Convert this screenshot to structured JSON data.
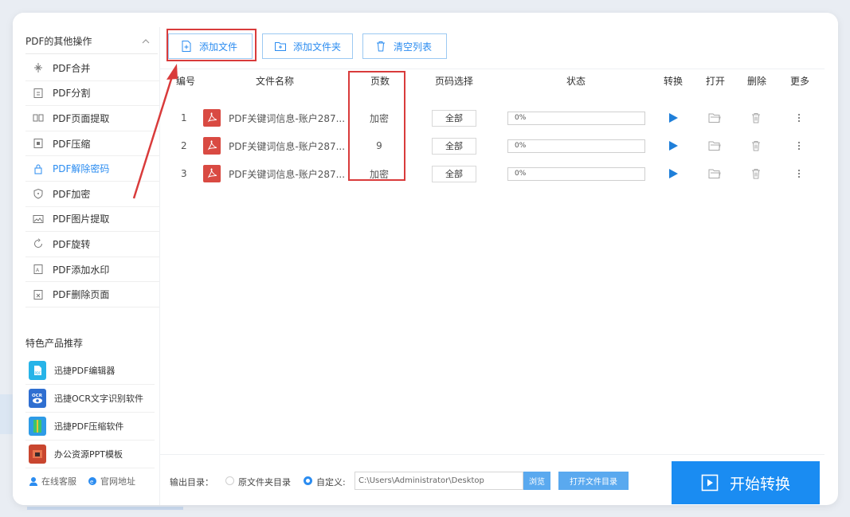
{
  "sidebar": {
    "header": "PDF的其他操作",
    "items": [
      {
        "label": "PDF合并",
        "icon": "merge-icon"
      },
      {
        "label": "PDF分割",
        "icon": "split-icon"
      },
      {
        "label": "PDF页面提取",
        "icon": "page-extract-icon"
      },
      {
        "label": "PDF压缩",
        "icon": "compress-icon"
      },
      {
        "label": "PDF解除密码",
        "icon": "unlock-icon",
        "active": true
      },
      {
        "label": "PDF加密",
        "icon": "shield-icon"
      },
      {
        "label": "PDF图片提取",
        "icon": "image-icon"
      },
      {
        "label": "PDF旋转",
        "icon": "rotate-icon"
      },
      {
        "label": "PDF添加水印",
        "icon": "watermark-icon"
      },
      {
        "label": "PDF删除页面",
        "icon": "delete-page-icon"
      }
    ],
    "promo_title": "特色产品推荐",
    "promo_items": [
      {
        "label": "迅捷PDF编辑器"
      },
      {
        "label": "迅捷OCR文字识别软件"
      },
      {
        "label": "迅捷PDF压缩软件"
      },
      {
        "label": "办公资源PPT模板"
      }
    ],
    "footer": {
      "service": "在线客服",
      "website": "官网地址"
    }
  },
  "toolbar": {
    "add_file": "添加文件",
    "add_folder": "添加文件夹",
    "clear_list": "清空列表"
  },
  "table": {
    "headers": {
      "no": "编号",
      "name": "文件名称",
      "pages": "页数",
      "range": "页码选择",
      "status": "状态",
      "convert": "转换",
      "open": "打开",
      "delete": "删除",
      "more": "更多"
    },
    "rows": [
      {
        "no": "1",
        "name": "PDF关键词信息-账户287...",
        "pages": "加密",
        "range": "全部",
        "progress": "0%"
      },
      {
        "no": "2",
        "name": "PDF关键词信息-账户287...",
        "pages": "9",
        "range": "全部",
        "progress": "0%"
      },
      {
        "no": "3",
        "name": "PDF关键词信息-账户287...",
        "pages": "加密",
        "range": "全部",
        "progress": "0%"
      }
    ]
  },
  "bottom": {
    "output_label": "输出目录：",
    "option_original": "原文件夹目录",
    "option_custom": "自定义:",
    "path": "C:\\Users\\Administrator\\Desktop",
    "browse": "浏览",
    "open_dir": "打开文件目录",
    "start": "开始转换"
  },
  "colors": {
    "accent": "#2b8cf0",
    "start_button": "#1a8cf2",
    "annotation_red": "#d93b3b",
    "pdf_icon": "#d94a42"
  }
}
